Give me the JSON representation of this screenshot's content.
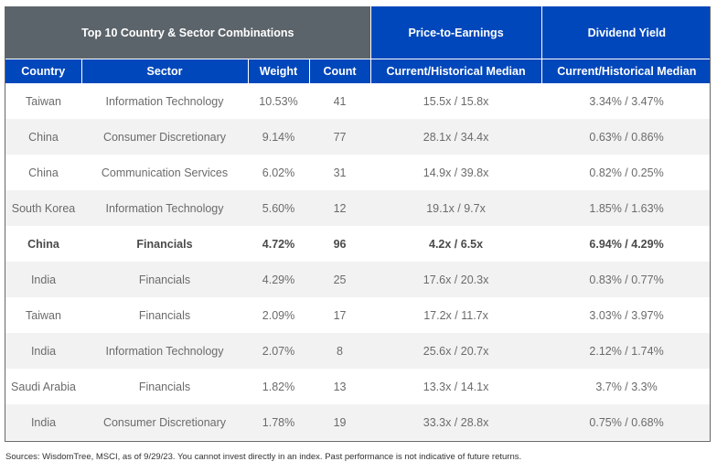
{
  "header": {
    "group_title": "Top 10 Country & Sector Combinations",
    "pe_title": "Price-to-Earnings",
    "dy_title": "Dividend Yield",
    "columns": [
      "Country",
      "Sector",
      "Weight",
      "Count",
      "Current/Historical Median",
      "Current/Historical Median"
    ]
  },
  "rows": [
    {
      "country": "Taiwan",
      "sector": "Information Technology",
      "weight": "10.53%",
      "count": "41",
      "pe": "15.5x / 15.8x",
      "dy": "3.34% / 3.47%",
      "highlight": false
    },
    {
      "country": "China",
      "sector": "Consumer Discretionary",
      "weight": "9.14%",
      "count": "77",
      "pe": "28.1x / 34.4x",
      "dy": "0.63% / 0.86%",
      "highlight": false
    },
    {
      "country": "China",
      "sector": "Communication Services",
      "weight": "6.02%",
      "count": "31",
      "pe": "14.9x / 39.8x",
      "dy": "0.82% / 0.25%",
      "highlight": false
    },
    {
      "country": "South Korea",
      "sector": "Information Technology",
      "weight": "5.60%",
      "count": "12",
      "pe": "19.1x / 9.7x",
      "dy": "1.85% / 1.63%",
      "highlight": false
    },
    {
      "country": "China",
      "sector": "Financials",
      "weight": "4.72%",
      "count": "96",
      "pe": "4.2x / 6.5x",
      "dy": "6.94% / 4.29%",
      "highlight": true
    },
    {
      "country": "India",
      "sector": "Financials",
      "weight": "4.29%",
      "count": "25",
      "pe": "17.6x / 20.3x",
      "dy": "0.83% / 0.77%",
      "highlight": false
    },
    {
      "country": "Taiwan",
      "sector": "Financials",
      "weight": "2.09%",
      "count": "17",
      "pe": "17.2x / 11.7x",
      "dy": "3.03% / 3.97%",
      "highlight": false
    },
    {
      "country": "India",
      "sector": "Information Technology",
      "weight": "2.07%",
      "count": "8",
      "pe": "25.6x / 20.7x",
      "dy": "2.12% / 1.74%",
      "highlight": false
    },
    {
      "country": "Saudi Arabia",
      "sector": "Financials",
      "weight": "1.82%",
      "count": "13",
      "pe": "13.3x / 14.1x",
      "dy": "3.7% / 3.3%",
      "highlight": false
    },
    {
      "country": "India",
      "sector": "Consumer Discretionary",
      "weight": "1.78%",
      "count": "19",
      "pe": "33.3x / 28.8x",
      "dy": "0.75% / 0.68%",
      "highlight": false
    }
  ],
  "footer": {
    "source": "Sources: WisdomTree, MSCI, as of 9/29/23. You cannot invest directly in an index. Past performance is not indicative of future returns."
  },
  "colors": {
    "header_grey": "#5c646b",
    "header_blue": "#0047bb",
    "row_alt": "#f2f2f2"
  }
}
